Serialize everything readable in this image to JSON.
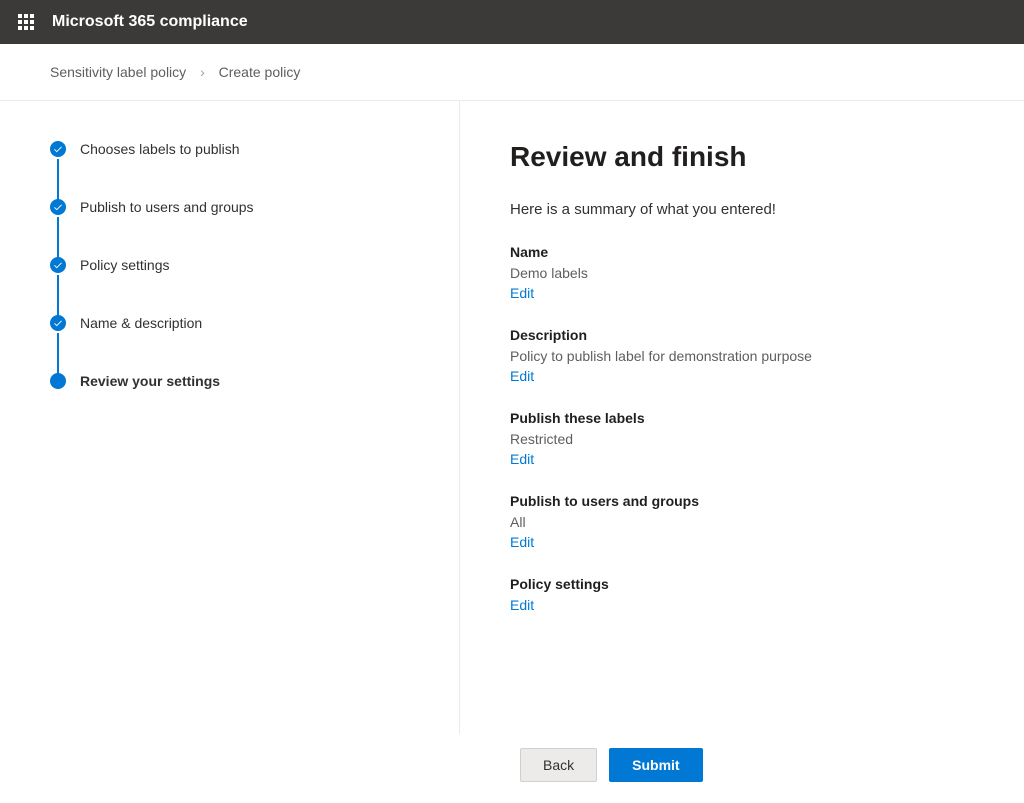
{
  "header": {
    "app_title": "Microsoft 365 compliance"
  },
  "breadcrumb": {
    "parent": "Sensitivity label policy",
    "current": "Create policy"
  },
  "steps": [
    {
      "label": "Chooses labels to publish",
      "state": "done"
    },
    {
      "label": "Publish to users and groups",
      "state": "done"
    },
    {
      "label": "Policy settings",
      "state": "done"
    },
    {
      "label": "Name & description",
      "state": "done"
    },
    {
      "label": "Review your settings",
      "state": "current"
    }
  ],
  "main": {
    "title": "Review and finish",
    "intro": "Here is a summary of what you entered!",
    "sections": [
      {
        "label": "Name",
        "value": "Demo labels",
        "edit": "Edit"
      },
      {
        "label": "Description",
        "value": "Policy to publish label for demonstration purpose",
        "edit": "Edit"
      },
      {
        "label": "Publish these labels",
        "value": "Restricted",
        "edit": "Edit"
      },
      {
        "label": "Publish to users and groups",
        "value": "All",
        "edit": "Edit"
      },
      {
        "label": "Policy settings",
        "value": "",
        "edit": "Edit"
      }
    ]
  },
  "footer": {
    "back": "Back",
    "submit": "Submit"
  }
}
